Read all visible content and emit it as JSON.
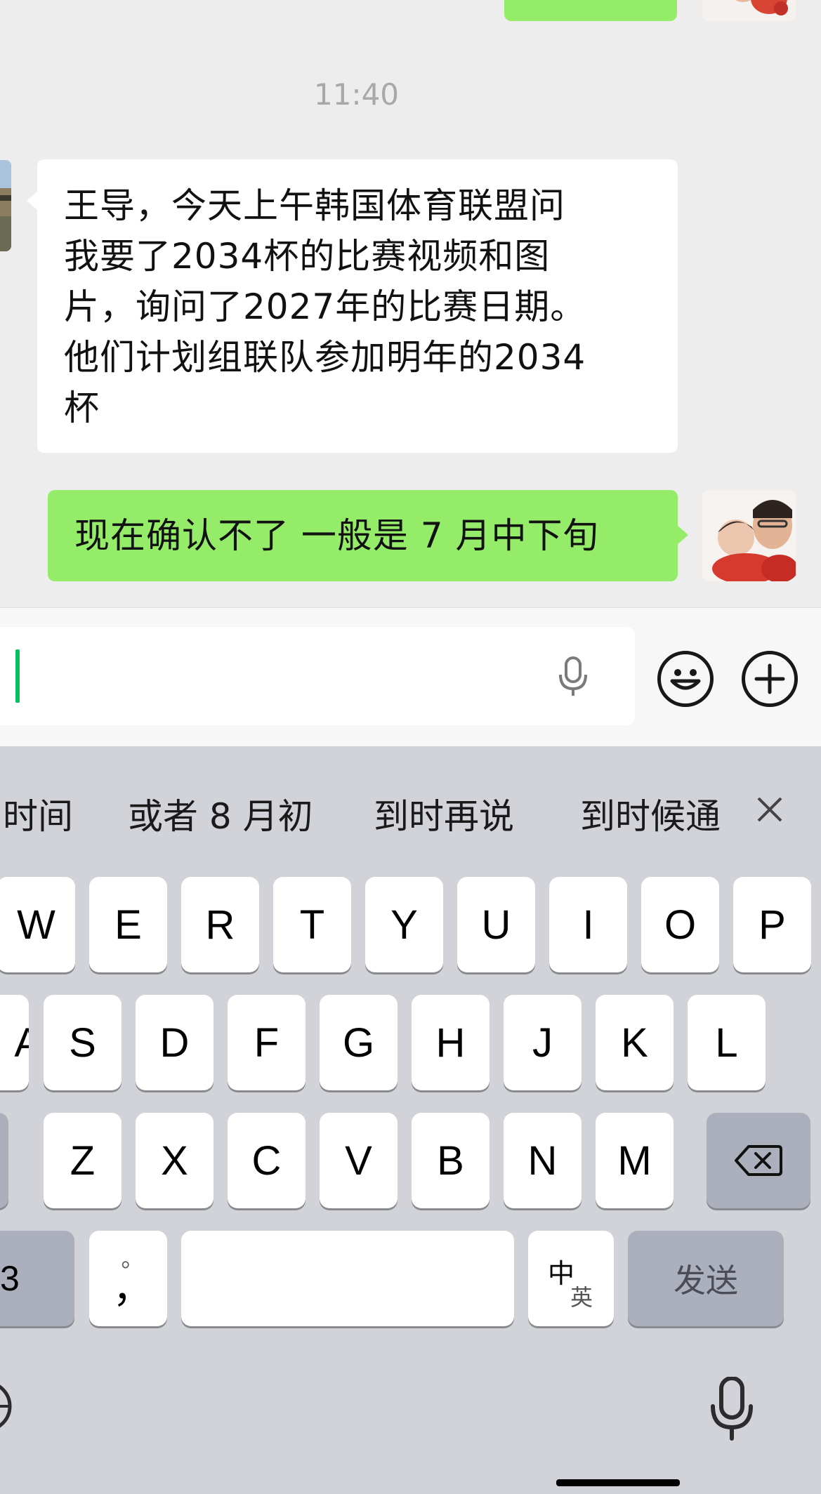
{
  "chat": {
    "timestamp": "11:40",
    "messages": [
      {
        "sender": "other",
        "lines": [
          "王导，今天上午韩国体育联盟问",
          "我要了2034杯的比赛视频和图",
          "片，询问了2027年的比赛日期。",
          "他们计划组联队参加明年的2034",
          "杯"
        ]
      },
      {
        "sender": "me",
        "text": "现在确认不了 一般是 7 月中下旬"
      }
    ]
  },
  "input_bar": {
    "value": "",
    "icons": [
      "microphone-icon",
      "emoji-icon",
      "plus-icon"
    ]
  },
  "keyboard": {
    "candidates": [
      "时间",
      "或者 8 月初",
      "到时再说",
      "到时候通"
    ],
    "row1": [
      "W",
      "E",
      "R",
      "T",
      "Y",
      "U",
      "I",
      "O",
      "P"
    ],
    "row2": [
      "A",
      "S",
      "D",
      "F",
      "G",
      "H",
      "J",
      "K",
      "L"
    ],
    "row3": [
      "Z",
      "X",
      "C",
      "V",
      "B",
      "N",
      "M"
    ],
    "numbers_key": "3",
    "punct_key_top": "。",
    "punct_key_bottom": "，",
    "lang_key_main": "中",
    "lang_key_sub": "英",
    "send_key": "发送"
  },
  "colors": {
    "my_bubble": "#95ec69",
    "other_bubble": "#ffffff",
    "chat_background": "#ededed",
    "keyboard_background": "#d1d3d9",
    "caret": "#07c160"
  }
}
